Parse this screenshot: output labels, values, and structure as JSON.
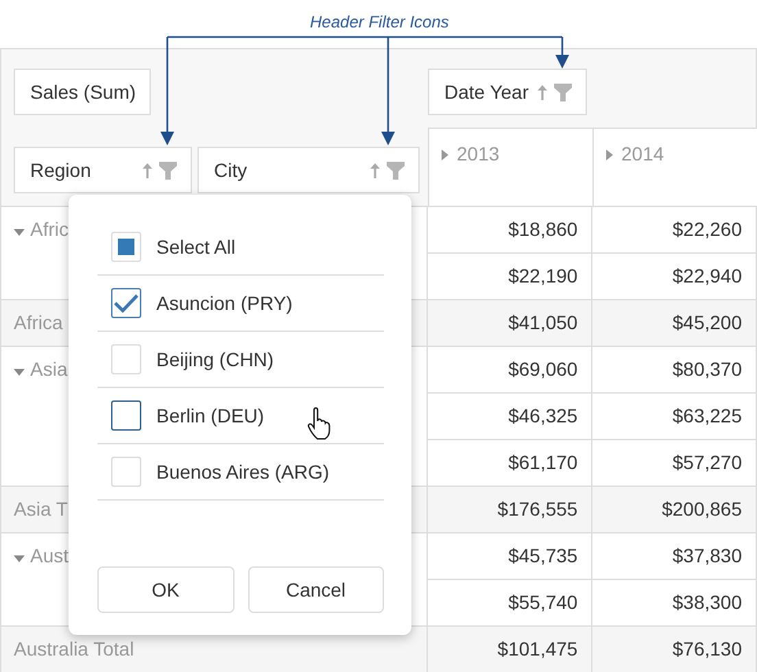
{
  "annotation": {
    "label": "Header Filter Icons"
  },
  "data_fields": [
    {
      "label": "Sales (Sum)",
      "kind": "data"
    }
  ],
  "row_fields": [
    {
      "label": "Region",
      "kind": "dimension"
    },
    {
      "label": "City",
      "kind": "dimension"
    }
  ],
  "column_fields": [
    {
      "label": "Date Year",
      "kind": "dimension"
    }
  ],
  "column_headers": [
    {
      "label": "2013",
      "expanded": false
    },
    {
      "label": "2014",
      "expanded": false
    }
  ],
  "rows": [
    {
      "kind": "group",
      "header": "Afric",
      "expanded": true,
      "values": [
        "$18,860",
        "$22,260"
      ]
    },
    {
      "kind": "item",
      "values": [
        "$22,190",
        "$22,940"
      ]
    },
    {
      "kind": "total",
      "header": "Africa",
      "values": [
        "$41,050",
        "$45,200"
      ]
    },
    {
      "kind": "group",
      "header": "Asia",
      "expanded": true,
      "values": [
        "$69,060",
        "$80,370"
      ]
    },
    {
      "kind": "item",
      "values": [
        "$46,325",
        "$63,225"
      ]
    },
    {
      "kind": "item",
      "values": [
        "$61,170",
        "$57,270"
      ]
    },
    {
      "kind": "total",
      "header": "Asia T",
      "values": [
        "$176,555",
        "$200,865"
      ]
    },
    {
      "kind": "group",
      "header": "Aust",
      "expanded": true,
      "values": [
        "$45,735",
        "$37,830"
      ]
    },
    {
      "kind": "item",
      "values": [
        "$55,740",
        "$38,300"
      ]
    },
    {
      "kind": "total",
      "header": "Australia Total",
      "values": [
        "$101,475",
        "$76,130"
      ]
    }
  ],
  "filter_popup": {
    "select_all": {
      "label": "Select All",
      "checked": false,
      "indeterminate": true
    },
    "items": [
      {
        "label": "Asuncion (PRY)",
        "checked": true,
        "hovered": false
      },
      {
        "label": "Beijing (CHN)",
        "checked": false,
        "hovered": false
      },
      {
        "label": "Berlin (DEU)",
        "checked": false,
        "hovered": true
      },
      {
        "label": "Buenos Aires (ARG)",
        "checked": false,
        "hovered": false
      }
    ],
    "buttons": [
      "OK",
      "Cancel"
    ]
  }
}
